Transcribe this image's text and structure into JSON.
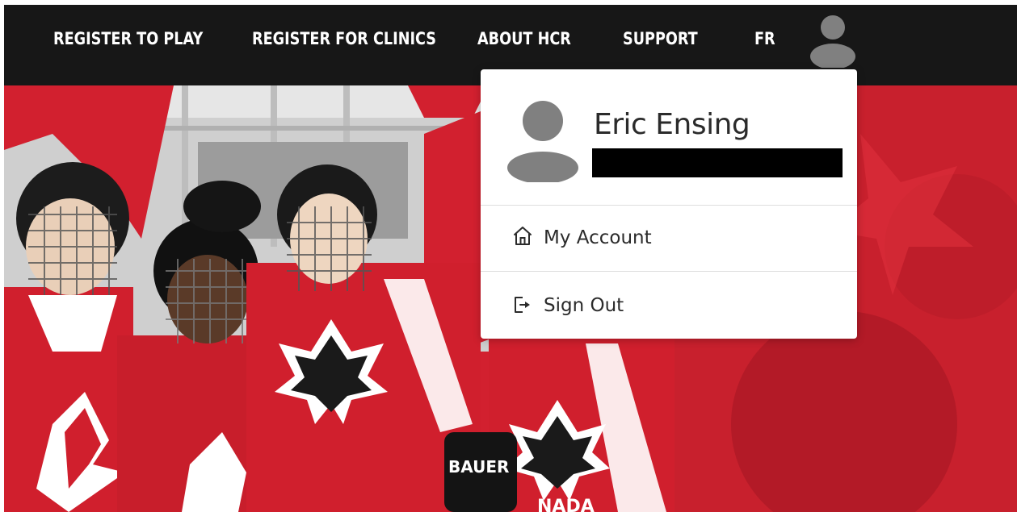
{
  "nav": {
    "items": [
      {
        "label": "REGISTER TO PLAY"
      },
      {
        "label": "REGISTER FOR CLINICS"
      },
      {
        "label": "ABOUT HCR"
      },
      {
        "label": "SUPPORT"
      },
      {
        "label": "FR"
      }
    ],
    "avatar_icon": "user-avatar-icon"
  },
  "dropdown": {
    "user_name": "Eric Ensing",
    "email_redacted": "",
    "menu": [
      {
        "label": "My Account",
        "icon": "home-icon"
      },
      {
        "label": "Sign Out",
        "icon": "sign-out-icon"
      }
    ]
  },
  "hero": {
    "jersey_brand": "BAUER",
    "jersey_text": "NADA"
  },
  "colors": {
    "navbar_bg": "#171717",
    "hero_red": "#d2202f",
    "text_dark": "#2b2b2b",
    "avatar_grey": "#808080"
  }
}
